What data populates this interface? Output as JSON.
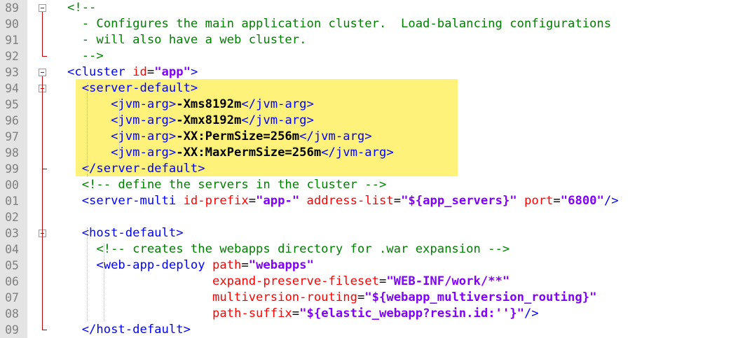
{
  "editor": {
    "line_numbers": [
      "89",
      "90",
      "91",
      "92",
      "93",
      "94",
      "95",
      "96",
      "97",
      "98",
      "99",
      "00",
      "01",
      "02",
      "03",
      "04",
      "05",
      "06",
      "07",
      "08",
      "09"
    ],
    "lines": [
      [
        {
          "t": "<!--",
          "c": "cmt"
        }
      ],
      [
        {
          "t": "  - Configures the main application cluster.  Load-balancing configurations",
          "c": "cmt"
        }
      ],
      [
        {
          "t": "  - will also have a web cluster.",
          "c": "cmt"
        }
      ],
      [
        {
          "t": "  -->",
          "c": "cmt"
        }
      ],
      [
        {
          "t": "<cluster ",
          "c": "tag"
        },
        {
          "t": "id",
          "c": "attr"
        },
        {
          "t": "=",
          "c": "eq"
        },
        {
          "t": "\"app\"",
          "c": "val"
        },
        {
          "t": ">",
          "c": "tag"
        }
      ],
      [
        {
          "t": "  <server-default>",
          "c": "tag"
        }
      ],
      [
        {
          "t": "      <jvm-arg>",
          "c": "tag"
        },
        {
          "t": "-Xms8192m",
          "c": "txt"
        },
        {
          "t": "</jvm-arg>",
          "c": "tag"
        }
      ],
      [
        {
          "t": "      <jvm-arg>",
          "c": "tag"
        },
        {
          "t": "-Xmx8192m",
          "c": "txt"
        },
        {
          "t": "</jvm-arg>",
          "c": "tag"
        }
      ],
      [
        {
          "t": "      <jvm-arg>",
          "c": "tag"
        },
        {
          "t": "-XX:PermSize=256m",
          "c": "txt"
        },
        {
          "t": "</jvm-arg>",
          "c": "tag"
        }
      ],
      [
        {
          "t": "      <jvm-arg>",
          "c": "tag"
        },
        {
          "t": "-XX:MaxPermSize=256m",
          "c": "txt"
        },
        {
          "t": "</jvm-arg>",
          "c": "tag"
        }
      ],
      [
        {
          "t": "  </server-default>",
          "c": "tag"
        }
      ],
      [
        {
          "t": "  <!-- define the servers in the cluster -->",
          "c": "cmt"
        }
      ],
      [
        {
          "t": "  <server-multi ",
          "c": "tag"
        },
        {
          "t": "id-prefix",
          "c": "attr"
        },
        {
          "t": "=",
          "c": "eq"
        },
        {
          "t": "\"app-\"",
          "c": "val"
        },
        {
          "t": " ",
          "c": "tag"
        },
        {
          "t": "address-list",
          "c": "attr"
        },
        {
          "t": "=",
          "c": "eq"
        },
        {
          "t": "\"${app_servers}\"",
          "c": "val"
        },
        {
          "t": " ",
          "c": "tag"
        },
        {
          "t": "port",
          "c": "attr"
        },
        {
          "t": "=",
          "c": "eq"
        },
        {
          "t": "\"6800\"",
          "c": "val"
        },
        {
          "t": "/>",
          "c": "tag"
        }
      ],
      [],
      [
        {
          "t": "  <host-default>",
          "c": "tag"
        }
      ],
      [
        {
          "t": "    <!-- creates the webapps directory for .war expansion -->",
          "c": "cmt"
        }
      ],
      [
        {
          "t": "    <web-app-deploy ",
          "c": "tag"
        },
        {
          "t": "path",
          "c": "attr"
        },
        {
          "t": "=",
          "c": "eq"
        },
        {
          "t": "\"webapps\"",
          "c": "val"
        }
      ],
      [
        {
          "t": "                    ",
          "c": "tag"
        },
        {
          "t": "expand-preserve-fileset",
          "c": "attr"
        },
        {
          "t": "=",
          "c": "eq"
        },
        {
          "t": "\"WEB-INF/work/**\"",
          "c": "val"
        }
      ],
      [
        {
          "t": "                    ",
          "c": "tag"
        },
        {
          "t": "multiversion-routing",
          "c": "attr"
        },
        {
          "t": "=",
          "c": "eq"
        },
        {
          "t": "\"${webapp_multiversion_routing}\"",
          "c": "val"
        }
      ],
      [
        {
          "t": "                    ",
          "c": "tag"
        },
        {
          "t": "path-suffix",
          "c": "attr"
        },
        {
          "t": "=",
          "c": "eq"
        },
        {
          "t": "\"${elastic_webapp?resin.id:''}\"",
          "c": "val"
        },
        {
          "t": "/>",
          "c": "tag"
        }
      ],
      [
        {
          "t": "  </host-default>",
          "c": "tag"
        }
      ]
    ],
    "fold_markers": [
      0,
      4,
      5,
      14
    ]
  }
}
